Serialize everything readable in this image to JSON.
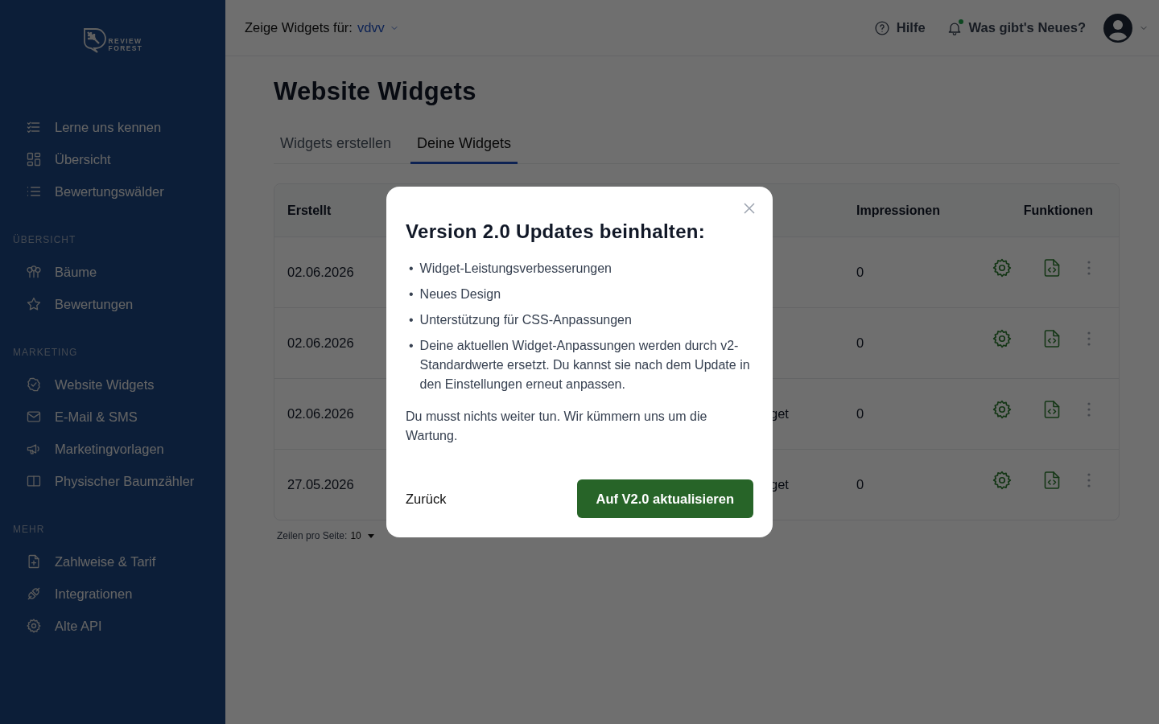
{
  "sidebar": {
    "logo": {
      "line_1": "REVIEW",
      "line_2": "FOREST"
    },
    "sections": [
      {
        "items": [
          {
            "label": "Lerne uns kennen"
          },
          {
            "label": "Übersicht"
          },
          {
            "label": "Bewertungswälder"
          }
        ]
      },
      {
        "heading": "ÜBERSICHT",
        "items": [
          {
            "label": "Bäume"
          },
          {
            "label": "Bewertungen"
          }
        ]
      },
      {
        "heading": "MARKETING",
        "items": [
          {
            "label": "Website Widgets"
          },
          {
            "label": "E-Mail & SMS"
          },
          {
            "label": "Marketingvorlagen"
          },
          {
            "label": "Physischer Baumzähler"
          }
        ]
      },
      {
        "heading": "MEHR",
        "items": [
          {
            "label": "Zahlweise & Tarif"
          },
          {
            "label": "Integrationen"
          },
          {
            "label": "Alte API"
          }
        ]
      }
    ]
  },
  "topbar": {
    "filter_label": "Zeige Widgets für:",
    "filter_value": "vdvv",
    "help": "Hilfe",
    "news": "Was gibt's Neues?"
  },
  "page": {
    "title": "Website Widgets",
    "tabs": [
      {
        "label": "Widgets erstellen",
        "selected": false
      },
      {
        "label": "Deine Widgets",
        "selected": true
      }
    ],
    "table": {
      "columns": [
        "Erstellt",
        "Impressionen",
        "Funktionen"
      ],
      "rows": [
        {
          "created": "02.06.2026",
          "impressions": "0"
        },
        {
          "created": "02.06.2026",
          "impressions": "0"
        },
        {
          "created": "02.06.2026",
          "column_2": "get",
          "impressions": "0"
        },
        {
          "created": "27.05.2026",
          "column_2": "get",
          "impressions": "0"
        }
      ]
    },
    "pagination": {
      "label": "Zeilen pro Seite:",
      "value": "10"
    }
  },
  "dialog": {
    "title": "Version 2.0 Updates beinhalten:",
    "bullets": [
      {
        "marker": "•",
        "text": "Widget-Leistungsverbesserungen"
      },
      {
        "marker": "•",
        "text": "Neues Design"
      },
      {
        "marker": "•",
        "text": "Unterstützung für CSS-Anpassungen"
      },
      {
        "marker": "•",
        "text": "Deine aktuellen Widget-Anpassungen werden durch v2-Standardwerte ersetzt. Du kannst sie nach dem Update in den Einstellungen erneut anpassen."
      }
    ],
    "note": "Du musst nichts weiter tun. Wir kümmern uns um die Wartung.",
    "secondary_button": "Zurück",
    "primary_button": "Auf V2.0 aktualisieren"
  }
}
